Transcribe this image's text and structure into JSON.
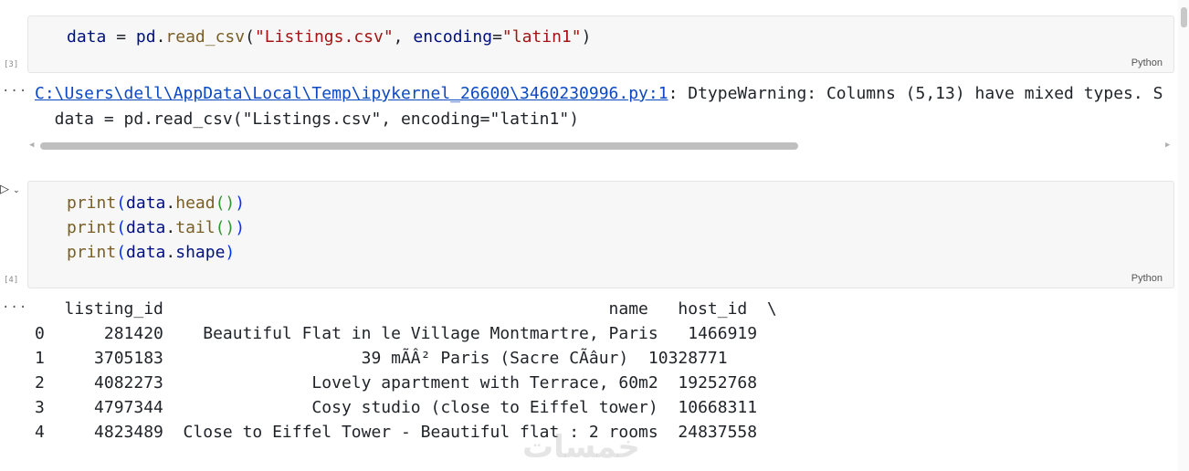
{
  "cell1": {
    "exec_count": "[3]",
    "code": {
      "var": "data",
      "op": " = ",
      "mod": "pd",
      "dot": ".",
      "fn": "read_csv",
      "open": "(",
      "arg1": "\"Listings.csv\"",
      "comma": ", ",
      "param": "encoding",
      "eq": "=",
      "arg2": "\"latin1\"",
      "close": ")"
    },
    "lang": "Python"
  },
  "warning": {
    "link": "C:\\Users\\dell\\AppData\\Local\\Temp\\ipykernel_26600\\3460230996.py:1",
    "message": ": DtypeWarning: Columns (5,13) have mixed types. S",
    "line2": "  data = pd.read_csv(\"Listings.csv\", encoding=\"latin1\")"
  },
  "cell2": {
    "exec_count": "[4]",
    "lines": [
      {
        "fn": "print",
        "open": "(",
        "obj": "data",
        "dot": ".",
        "meth": "head",
        "inner": "()",
        "close": ")"
      },
      {
        "fn": "print",
        "open": "(",
        "obj": "data",
        "dot": ".",
        "meth": "tail",
        "inner": "()",
        "close": ")"
      },
      {
        "fn": "print",
        "open": "(",
        "obj": "data",
        "dot": ".",
        "meth": "shape",
        "inner": "",
        "close": ")"
      }
    ],
    "lang": "Python"
  },
  "output": {
    "header": "   listing_id                                             name   host_id  \\",
    "rows": [
      "0      281420    Beautiful Flat in le Village Montmartre, Paris   1466919   ",
      "1     3705183                    39 mÃ­Â² Paris (Sacre CÃ­â­­ur)  10328771   ",
      "2     4082273               Lovely apartment with Terrace, 60m2  19252768   ",
      "3     4797344               Cosy studio (close to Eiffel tower)  10668311   ",
      "4     4823489  Close to Eiffel Tower - Beautiful flat : 2 rooms  24837558   "
    ]
  },
  "ellipsis": "...",
  "watermark": "خمسات"
}
